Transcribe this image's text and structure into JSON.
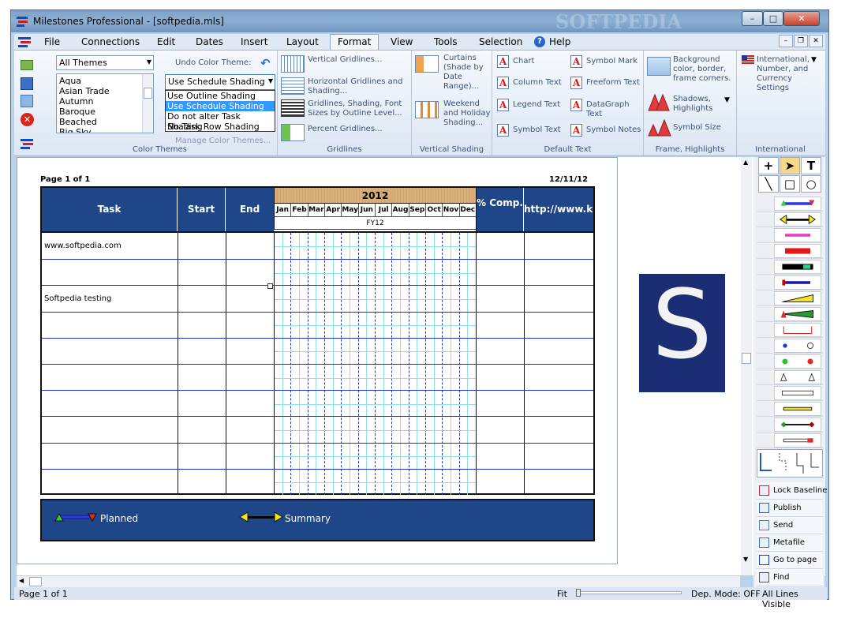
{
  "window": {
    "title": "Milestones Professional - [softpedia.mls]",
    "watermark": "SOFTPEDIA",
    "min_label": "–",
    "max_label": "□",
    "close_label": "✕"
  },
  "menu": {
    "items": [
      "File",
      "Connections",
      "Edit",
      "Dates",
      "Insert",
      "Layout",
      "Format",
      "View",
      "Tools",
      "Selection",
      "Help"
    ],
    "active": "Format"
  },
  "ribbon": {
    "color_themes": {
      "label": "Color Themes",
      "theme_select": "All Themes",
      "undo_label": "Undo Color Theme:",
      "list": [
        "Aqua",
        "Asian Trade",
        "Autumn",
        "Baroque",
        "Beached",
        "Big Sky"
      ],
      "shading_select": "Use Schedule Shading",
      "shading_options": [
        "Use Outline Shading",
        "Use Schedule Shading",
        "Do not alter Task Shading",
        "No Task Row Shading"
      ],
      "manage_label": "Manage Color Themes..."
    },
    "gridlines": {
      "label": "Gridlines",
      "items": [
        "Vertical Gridlines...",
        "Horizontal Gridlines and Shading...",
        "Gridlines, Shading, Font Sizes by Outline Level...",
        "Percent Gridlines..."
      ]
    },
    "vertical_shading": {
      "label": "Vertical Shading",
      "items": [
        "Curtains (Shade by Date Range)...",
        "Weekend and Holiday Shading..."
      ]
    },
    "default_text": {
      "label": "Default Text",
      "items": [
        "Chart",
        "Symbol Mark",
        "Column Text",
        "Freeform Text",
        "Legend Text",
        "DataGraph Text",
        "Symbol Text",
        "Symbol Notes"
      ]
    },
    "frame": {
      "label": "Frame, Highlights",
      "items": [
        "Background color, border, frame corners.",
        "Shadows, Highlights",
        "Symbol Size"
      ]
    },
    "international": {
      "label": "International",
      "text": "International, Number, and Currency Settings"
    }
  },
  "schedule": {
    "page_label": "Page 1 of 1",
    "date": "12/11/12",
    "columns": [
      "Task",
      "Start",
      "End"
    ],
    "year": "2012",
    "months": [
      "Jan",
      "Feb",
      "Mar",
      "Apr",
      "May",
      "Jun",
      "Jul",
      "Aug",
      "Sep",
      "Oct",
      "Nov",
      "Dec"
    ],
    "fiscal": "FY12",
    "pct_label": "% Comp.",
    "url_col": "http://www.kid",
    "rows": [
      "www.softpedia.com",
      "",
      "Softpedia testing",
      "",
      "",
      "",
      "",
      "",
      "",
      ""
    ]
  },
  "legend": {
    "planned": "Planned",
    "summary": "Summary"
  },
  "logo_letter": "S",
  "palette": {
    "tools": [
      "+",
      "➤",
      "T",
      "╲",
      "□",
      "○"
    ],
    "actions": [
      "Lock Baseline",
      "Publish",
      "Send",
      "Metafile",
      "Go to page",
      "Find"
    ]
  },
  "status": {
    "page": "Page 1 of 1",
    "fit": "Fit",
    "dep_mode": "Dep. Mode: OFF",
    "lines": "All Lines Visible"
  },
  "colors": {
    "header_blue": "#1f4688",
    "year_tan": "#d9b07a",
    "grid_cyan": "#3fc4d1"
  }
}
